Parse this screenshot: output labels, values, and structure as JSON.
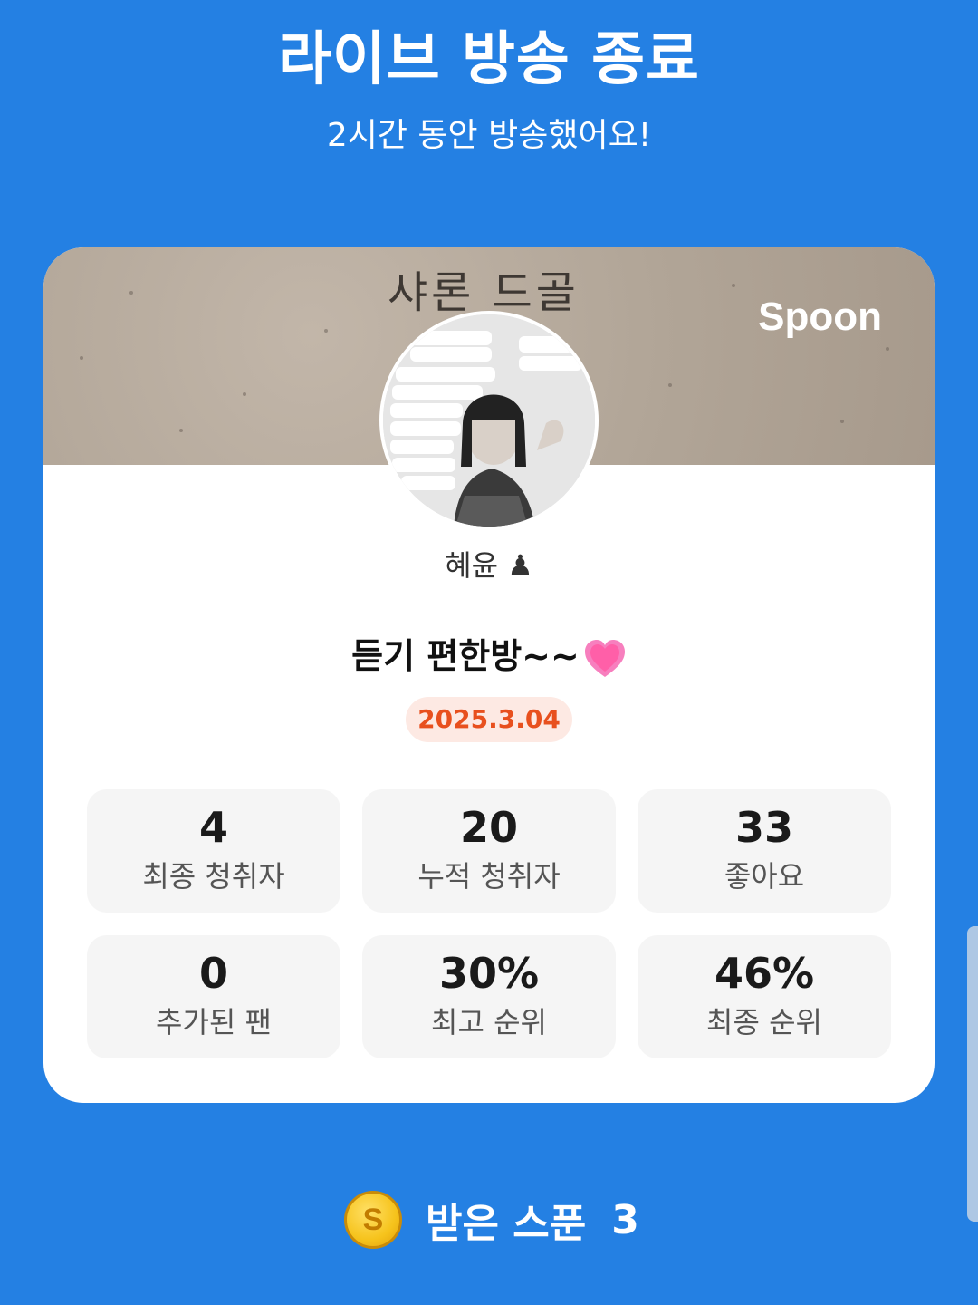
{
  "header": {
    "title": "라이브 방송 종료",
    "subtitle": "2시간 동안 방송했어요!"
  },
  "card": {
    "banner_text": "샤론 드골",
    "brand": "Spoon",
    "profile_name": "혜윤 ♟",
    "broadcast_title": "듣기 편한방~~",
    "title_icon": "pink-heart-icon",
    "date": "2025.3.04",
    "stats": [
      {
        "value": "4",
        "label": "최종 청취자"
      },
      {
        "value": "20",
        "label": "누적 청취자"
      },
      {
        "value": "33",
        "label": "좋아요"
      },
      {
        "value": "0",
        "label": "추가된 팬"
      },
      {
        "value": "30%",
        "label": "최고 순위"
      },
      {
        "value": "46%",
        "label": "최종 순위"
      }
    ]
  },
  "spoons": {
    "icon": "spoon-coin-icon",
    "coin_letter": "S",
    "label": "받은 스푼",
    "count": "3"
  },
  "colors": {
    "background": "#2480E3",
    "card": "#FFFFFF",
    "date_badge_bg": "#FDE9E3",
    "date_badge_text": "#E8501E",
    "stat_bg": "#F5F5F5"
  }
}
